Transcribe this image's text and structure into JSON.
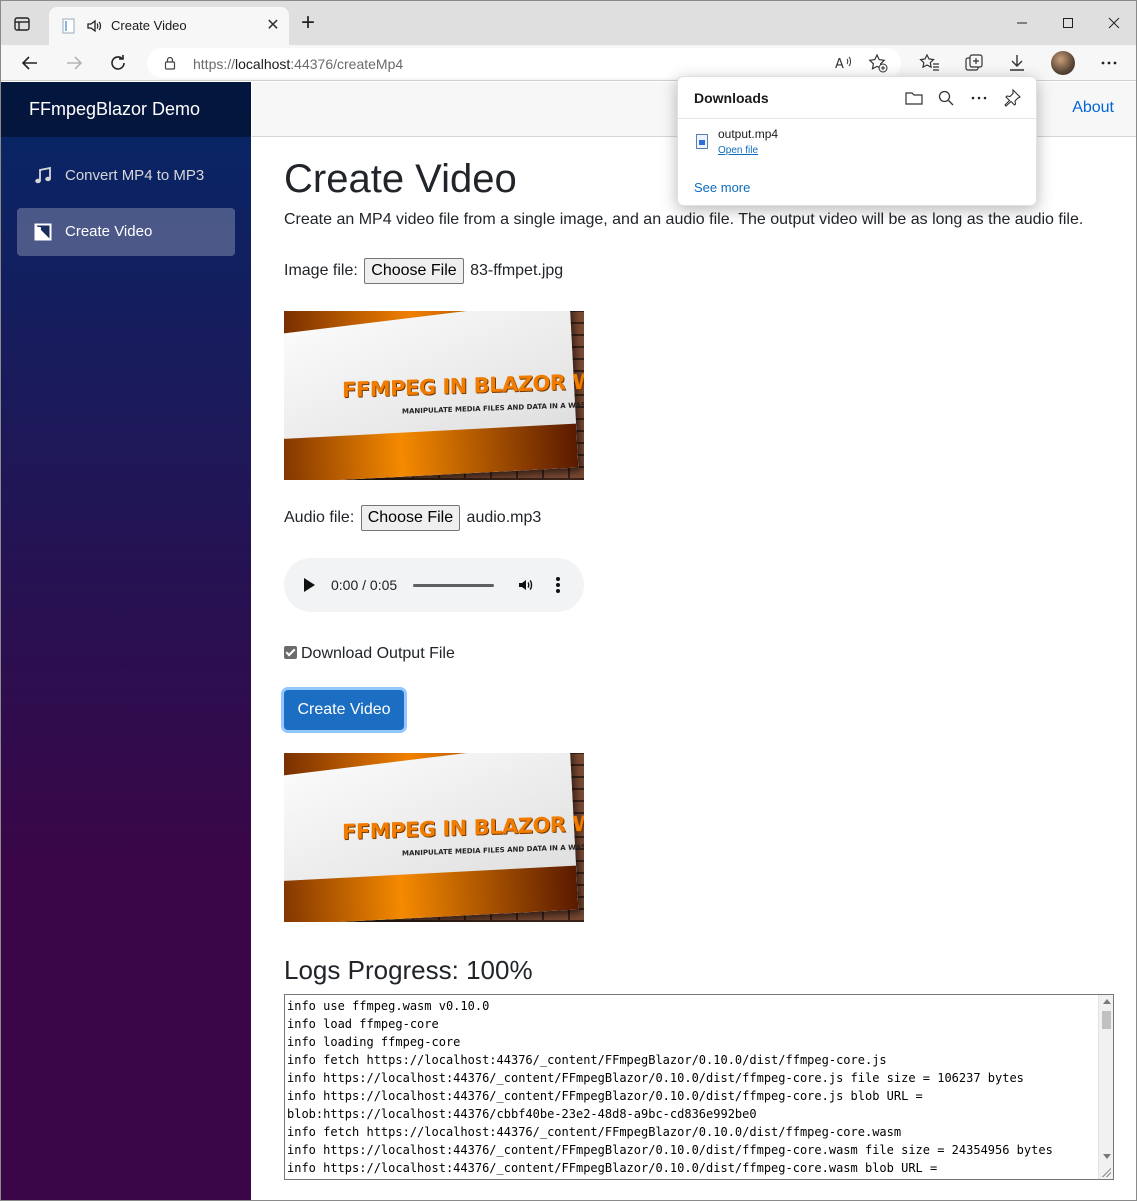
{
  "browser": {
    "tab_title": "Create Video",
    "url_prefix": "https://",
    "url_host": "localhost",
    "url_rest": ":44376/createMp4"
  },
  "downloads": {
    "title": "Downloads",
    "file_name": "output.mp4",
    "open_label": "Open file",
    "see_more": "See more"
  },
  "sidebar": {
    "brand": "FFmpegBlazor Demo",
    "items": [
      {
        "label": "Convert MP4 to MP3",
        "icon": "music-note-icon"
      },
      {
        "label": "Create Video",
        "icon": "image-icon"
      }
    ]
  },
  "topbar": {
    "about": "About"
  },
  "page": {
    "title": "Create Video",
    "description": "Create an MP4 video file from a single image, and an audio file. The output video will be as long as the audio file.",
    "image_label": "Image file:",
    "image_button": "Choose File",
    "image_file": "83-ffmpet.jpg",
    "poster_title": "FFMPEG IN BLAZOR WASM",
    "poster_subtitle": "MANIPULATE MEDIA FILES AND DATA IN A WASM APP",
    "audio_label": "Audio file:",
    "audio_button": "Choose File",
    "audio_file": "audio.mp3",
    "audio_time": "0:00 / 0:05",
    "checkbox_label": "Download Output File",
    "create_button": "Create Video",
    "logs_title": "Logs Progress: 100%",
    "logs": "info use ffmpeg.wasm v0.10.0\ninfo load ffmpeg-core\ninfo loading ffmpeg-core\ninfo fetch https://localhost:44376/_content/FFmpegBlazor/0.10.0/dist/ffmpeg-core.js\ninfo https://localhost:44376/_content/FFmpegBlazor/0.10.0/dist/ffmpeg-core.js file size = 106237 bytes\ninfo https://localhost:44376/_content/FFmpegBlazor/0.10.0/dist/ffmpeg-core.js blob URL =\nblob:https://localhost:44376/cbbf40be-23e2-48d8-a9bc-cd836e992be0\ninfo fetch https://localhost:44376/_content/FFmpegBlazor/0.10.0/dist/ffmpeg-core.wasm\ninfo https://localhost:44376/_content/FFmpegBlazor/0.10.0/dist/ffmpeg-core.wasm file size = 24354956 bytes\ninfo https://localhost:44376/_content/FFmpegBlazor/0.10.0/dist/ffmpeg-core.wasm blob URL ="
  }
}
